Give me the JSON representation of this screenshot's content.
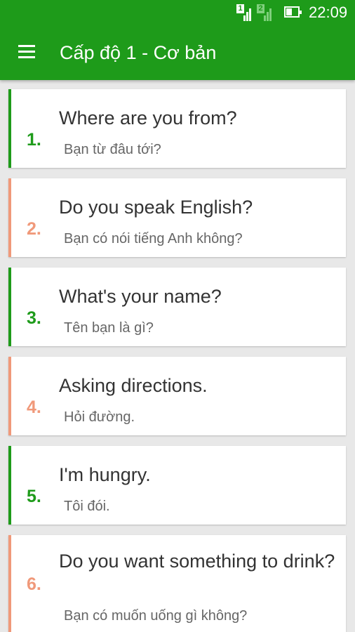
{
  "status_bar": {
    "sim1_label": "1",
    "sim2_label": "2",
    "time": "22:09"
  },
  "app_bar": {
    "menu_icon": "hamburger-menu-icon",
    "title": "Cấp độ 1 - Cơ bản"
  },
  "colors": {
    "primary": "#1e9b1a",
    "accent_orange": "#f0997a",
    "green_number": "#1e9b1a"
  },
  "lessons": [
    {
      "number": "1.",
      "english": "Where are you from?",
      "vietnamese": "Bạn từ đâu tới?",
      "accent": "green"
    },
    {
      "number": "2.",
      "english": "Do you speak English?",
      "vietnamese": "Bạn có nói tiếng Anh không?",
      "accent": "orange"
    },
    {
      "number": "3.",
      "english": "What's your name?",
      "vietnamese": "Tên bạn là gì?",
      "accent": "green"
    },
    {
      "number": "4.",
      "english": "Asking directions.",
      "vietnamese": "Hỏi đường.",
      "accent": "orange"
    },
    {
      "number": "5.",
      "english": "I'm hungry.",
      "vietnamese": "Tôi đói.",
      "accent": "green"
    },
    {
      "number": "6.",
      "english": "Do you want something to drink?",
      "vietnamese": "Bạn có muốn uống gì không?",
      "accent": "orange"
    }
  ]
}
